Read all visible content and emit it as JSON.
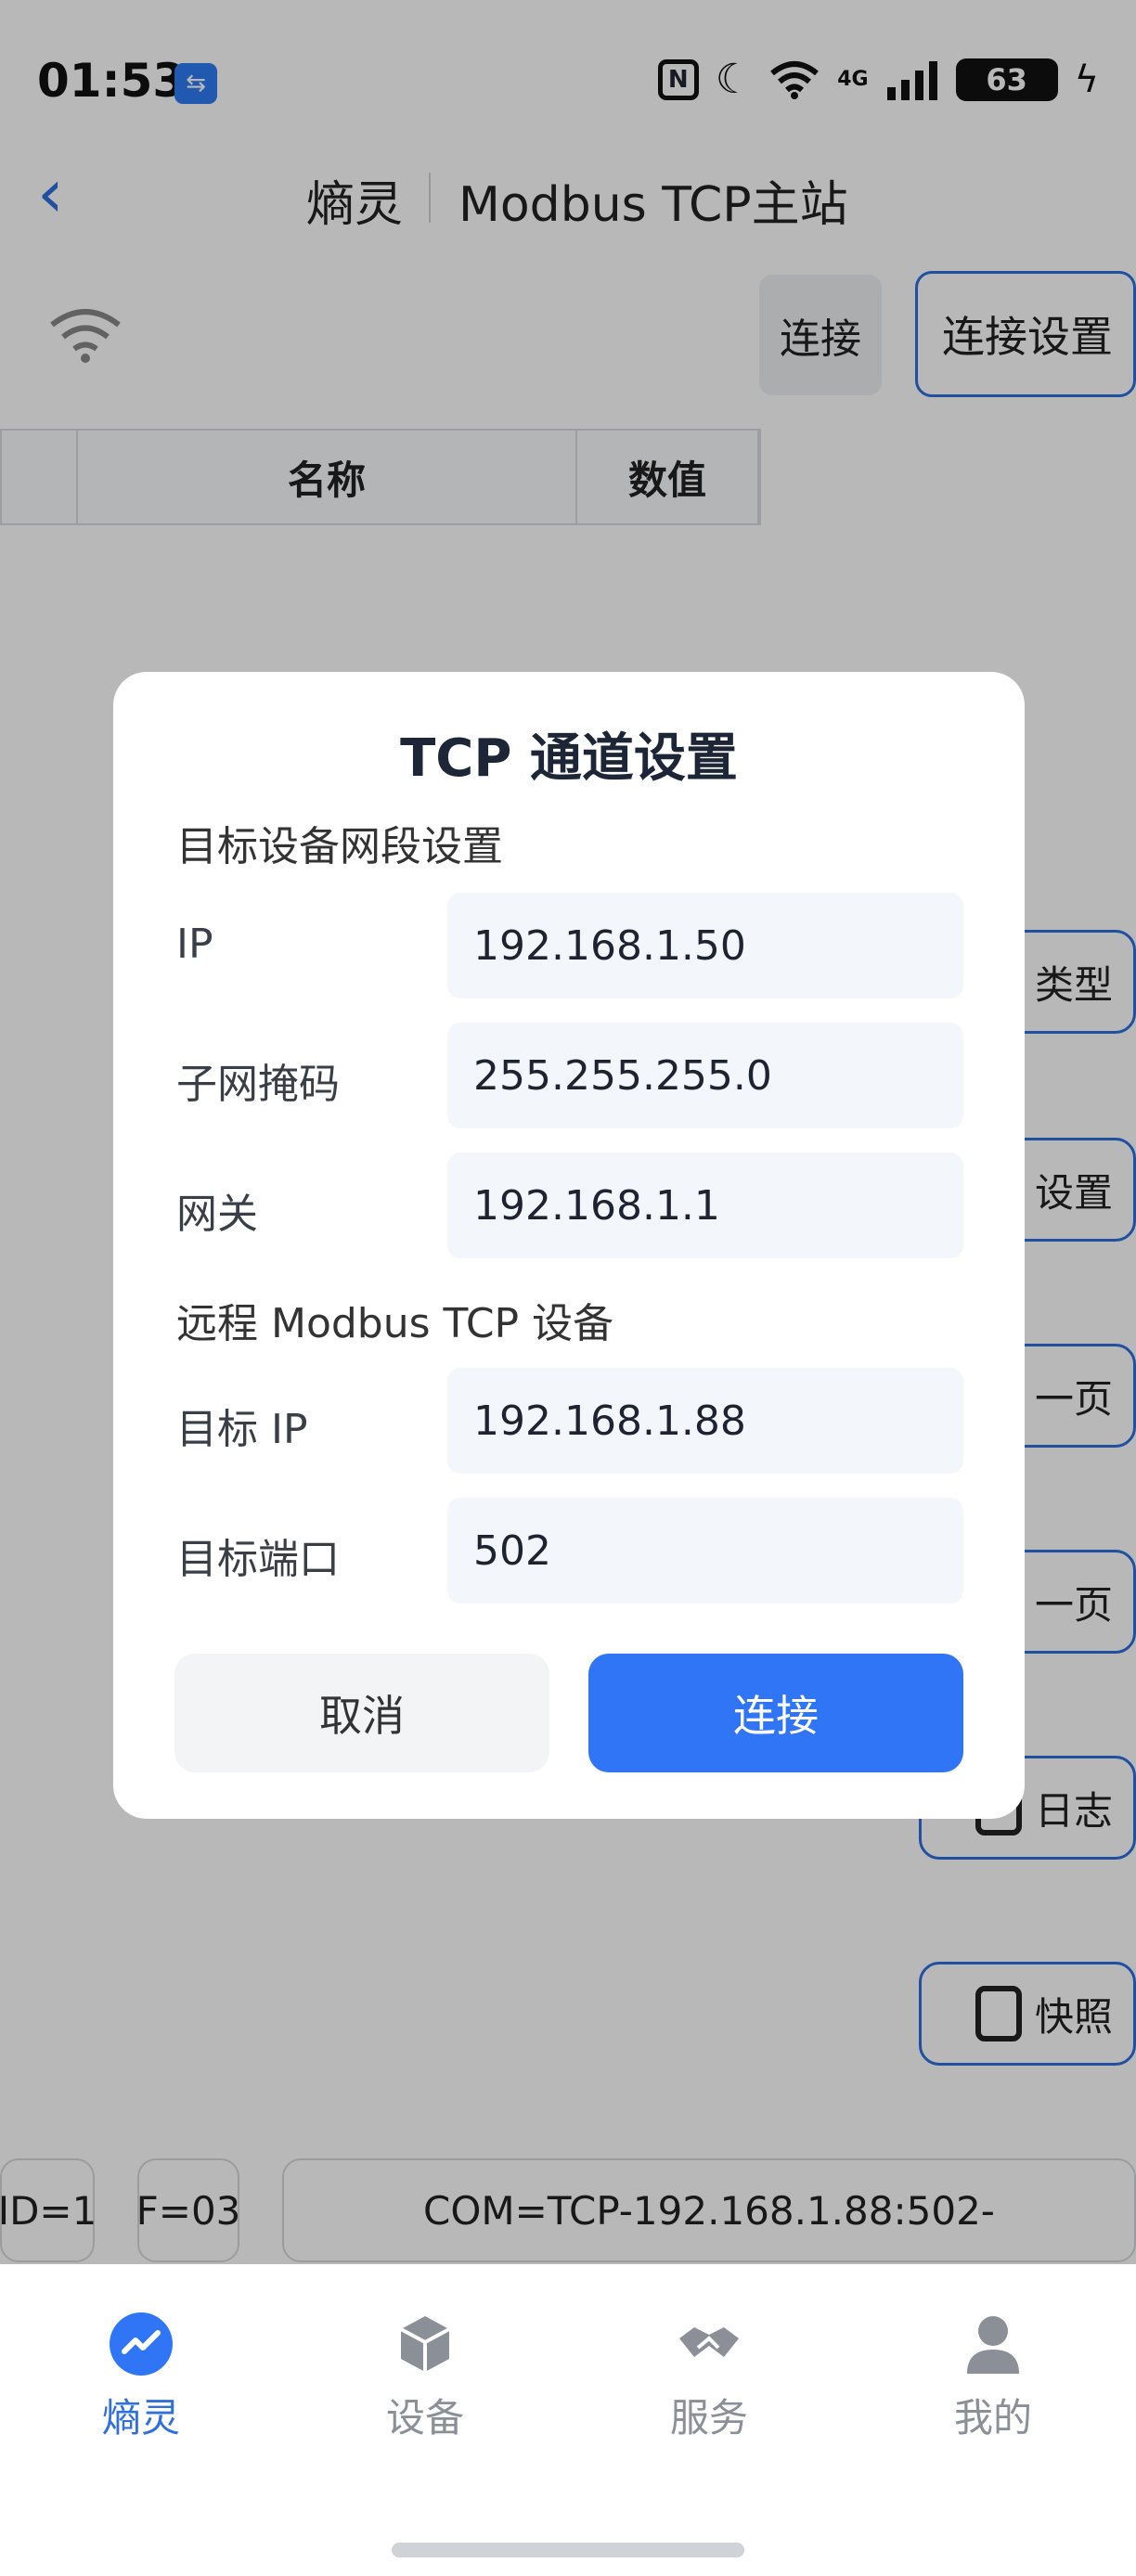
{
  "status_bar": {
    "time": "01:53",
    "network": "4G",
    "battery": "63"
  },
  "header": {
    "app_name": "熵灵",
    "title": "Modbus TCP主站"
  },
  "toolbar": {
    "connect_label": "连接",
    "settings_label": "连接设置"
  },
  "table": {
    "columns": [
      "名称",
      "数值"
    ]
  },
  "side_buttons": [
    "类型",
    "设置",
    "一页",
    "一页",
    "日志",
    "快照"
  ],
  "bottom_status": {
    "id": "ID=1",
    "func": "F=03",
    "com": "COM=TCP-192.168.1.88:502-"
  },
  "tabs": [
    {
      "label": "熵灵",
      "icon": "chart-icon",
      "active": true
    },
    {
      "label": "设备",
      "icon": "cube-icon",
      "active": false
    },
    {
      "label": "服务",
      "icon": "handshake-icon",
      "active": false
    },
    {
      "label": "我的",
      "icon": "user-icon",
      "active": false
    }
  ],
  "dialog": {
    "title": "TCP 通道设置",
    "section1": "目标设备网段设置",
    "section2": "远程 Modbus TCP 设备",
    "fields": [
      {
        "label": "IP",
        "value": "192.168.1.50"
      },
      {
        "label": "子网掩码",
        "value": "255.255.255.0"
      },
      {
        "label": "网关",
        "value": "192.168.1.1"
      },
      {
        "label": "目标 IP",
        "value": "192.168.1.88"
      },
      {
        "label": "目标端口",
        "value": "502"
      }
    ],
    "cancel_label": "取消",
    "confirm_label": "连接"
  },
  "colors": {
    "accent": "#2f75f6",
    "outline": "#2f6fde"
  }
}
